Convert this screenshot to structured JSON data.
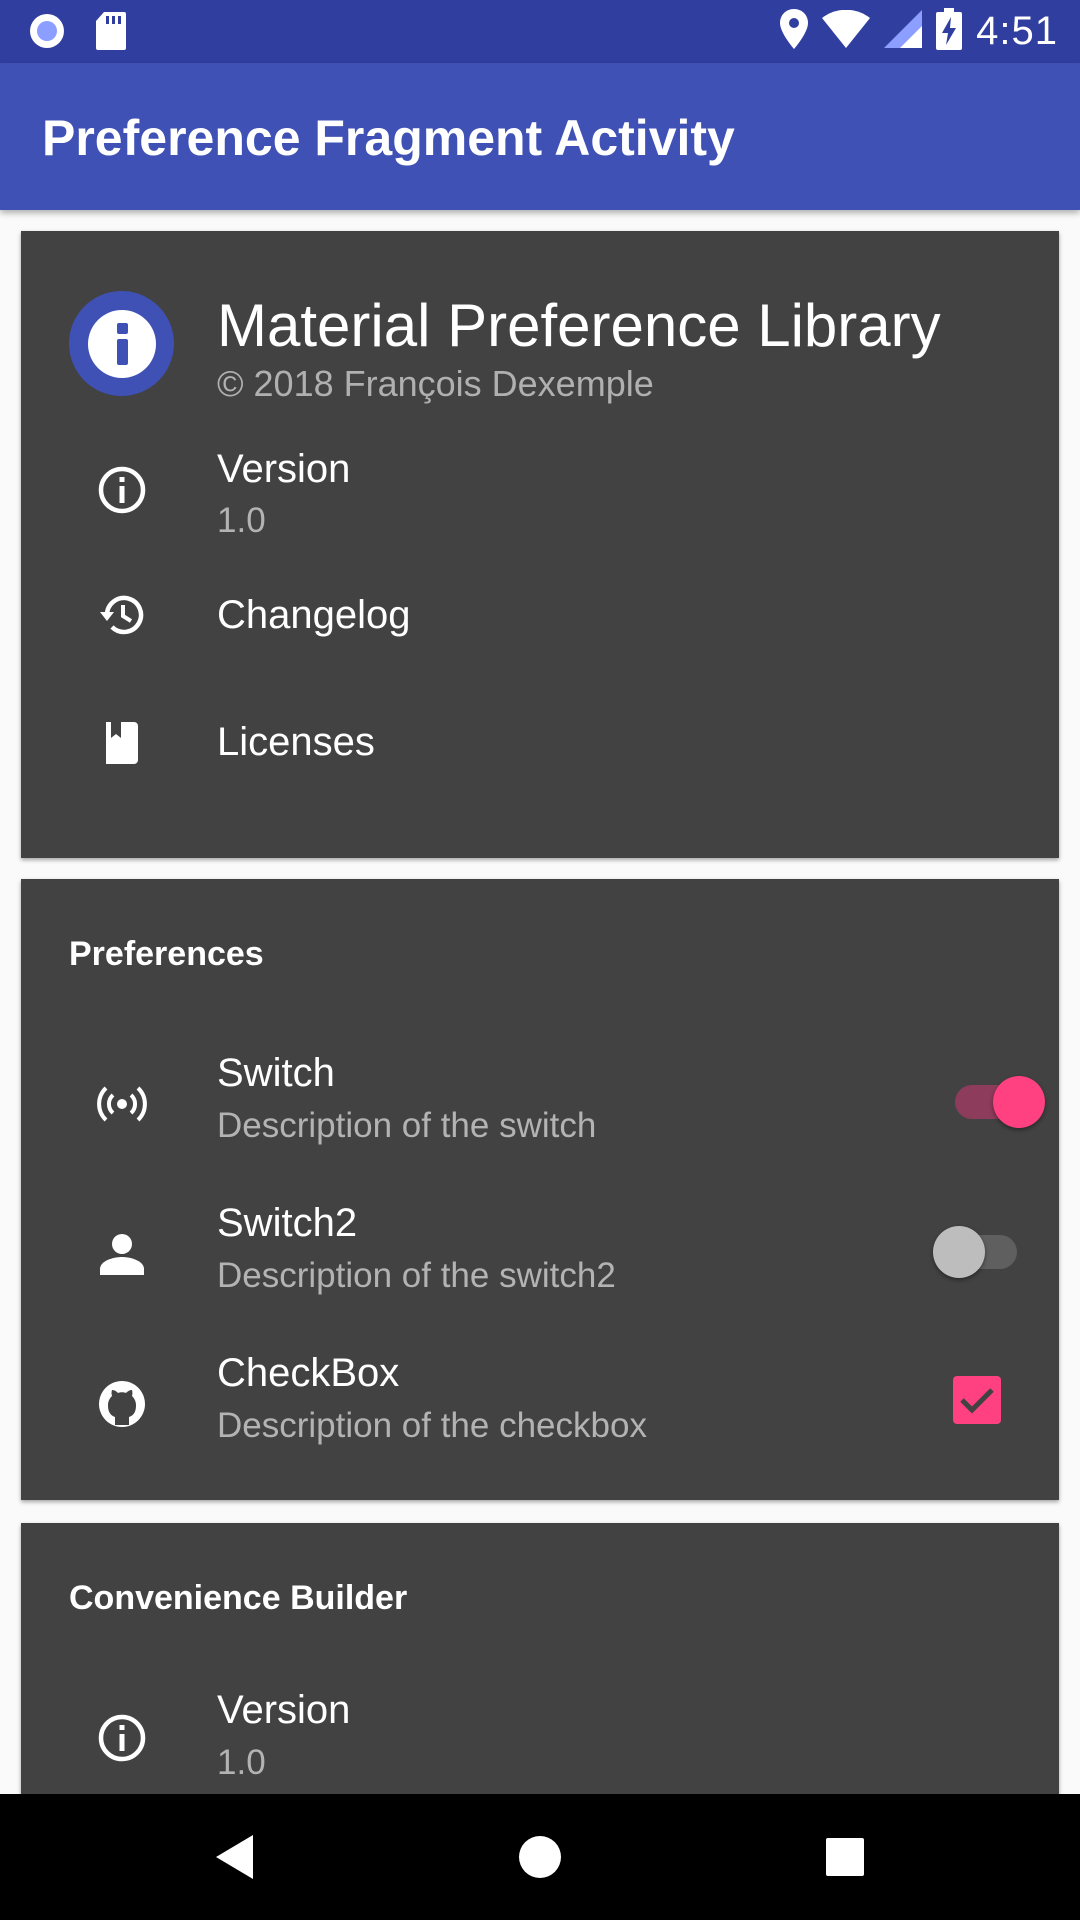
{
  "status_bar": {
    "time": "4:51",
    "left_icons": [
      "notification-circle-icon",
      "sd-card-icon"
    ],
    "right_icons": [
      "location-icon",
      "wifi-icon",
      "cell-signal-icon",
      "battery-charging-icon"
    ]
  },
  "app_bar": {
    "title": "Preference Fragment Activity"
  },
  "about_card": {
    "title": "Material Preference Library",
    "subtitle": "© 2018 François Dexemple",
    "items": [
      {
        "icon": "info-icon",
        "title": "Version",
        "summary": "1.0"
      },
      {
        "icon": "history-icon",
        "title": "Changelog"
      },
      {
        "icon": "book-icon",
        "title": "Licenses"
      }
    ]
  },
  "preferences_card": {
    "title": "Preferences",
    "items": [
      {
        "icon": "wireless-icon",
        "title": "Switch",
        "summary": "Description of the switch",
        "checked": true
      },
      {
        "icon": "person-icon",
        "title": "Switch2",
        "summary": "Description of the switch2",
        "checked": false
      },
      {
        "icon": "github-icon",
        "title": "CheckBox",
        "summary": "Description of the checkbox",
        "checked": true
      }
    ]
  },
  "builder_card": {
    "title": "Convenience Builder",
    "items": [
      {
        "icon": "info-icon",
        "title": "Version",
        "summary": "1.0"
      }
    ]
  },
  "colors": {
    "primary": "#3f51b5",
    "primary_dark": "#303f9f",
    "accent": "#ff4081",
    "card": "#424242"
  },
  "nav_bar": {
    "buttons": [
      "back-button",
      "home-button",
      "recents-button"
    ]
  }
}
